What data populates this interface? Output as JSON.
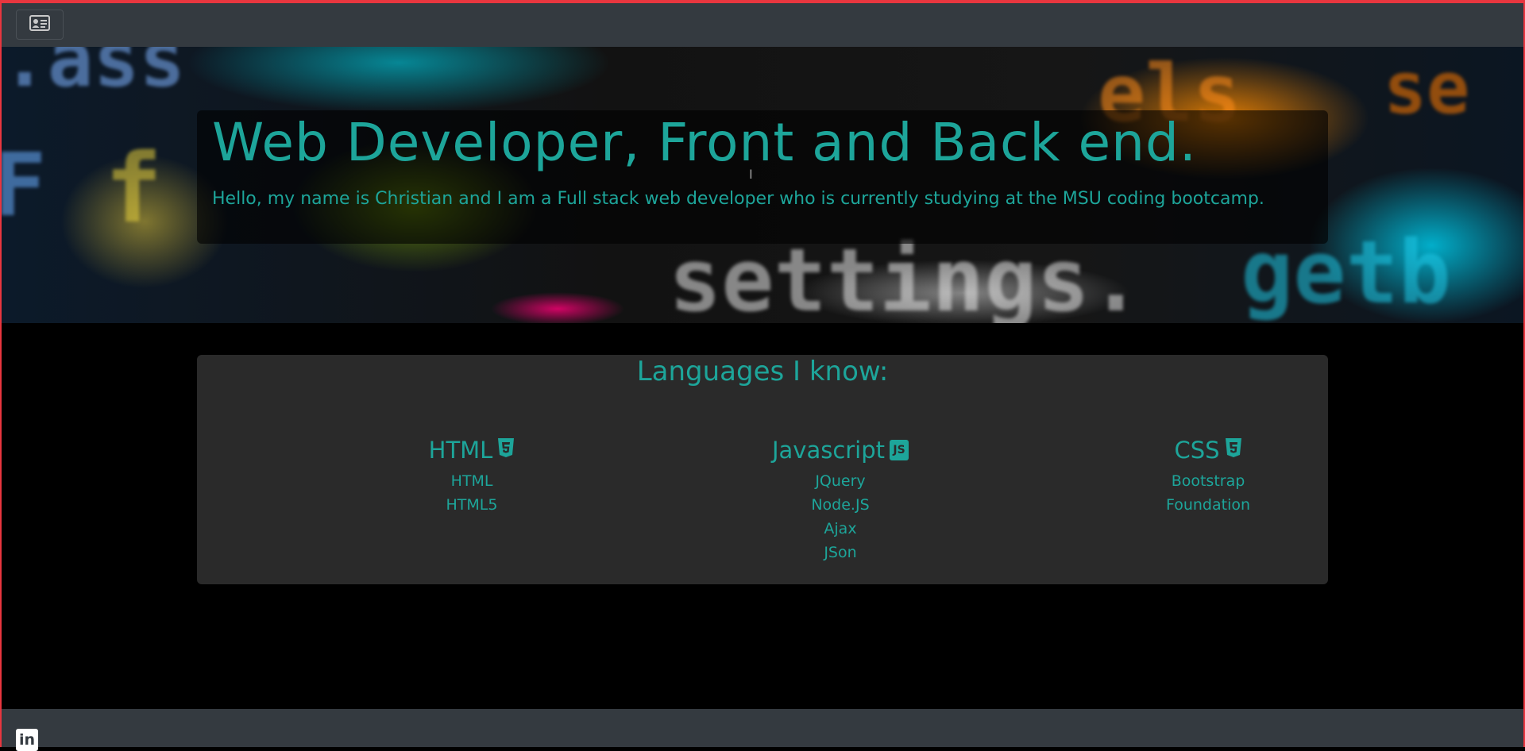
{
  "navbar": {
    "toggle_icon": "id-card-icon"
  },
  "hero": {
    "title": "Web Developer, Front and Back end.",
    "lead": "Hello, my name is Christian and I am a Full stack web developer who is currently studying at the MSU coding bootcamp."
  },
  "languages": {
    "heading": "Languages I know:",
    "columns": [
      {
        "name": "HTML",
        "icon": "html5-icon",
        "items": [
          "HTML",
          "HTML5"
        ]
      },
      {
        "name": "Javascript",
        "icon": "js-icon",
        "items": [
          "JQuery",
          "Node.JS",
          "Ajax",
          "JSon"
        ]
      },
      {
        "name": "CSS",
        "icon": "css3-icon",
        "items": [
          "Bootstrap",
          "Foundation"
        ]
      }
    ]
  },
  "footer": {
    "linkedin_icon": "linkedin-icon"
  },
  "colors": {
    "accent": "#1da59a",
    "navbar": "#343a40",
    "card": "#2a2a2a",
    "border": "#e8363f"
  }
}
